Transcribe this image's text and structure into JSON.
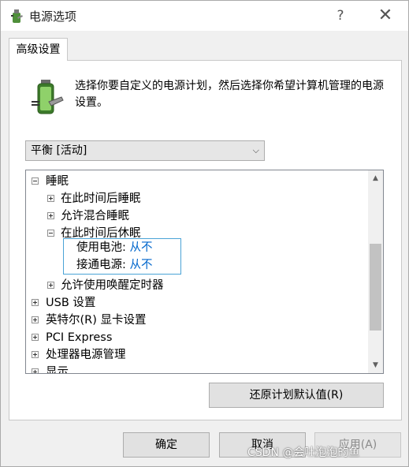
{
  "window": {
    "title": "电源选项",
    "help": "?",
    "close": "✕"
  },
  "tabs": [
    {
      "label": "高级设置"
    }
  ],
  "description": "选择你要自定义的电源计划，然后选择你希望计算机管理的电源设置。",
  "plan_select": {
    "value": "平衡 [活动]",
    "arrow": "⌵"
  },
  "tree": {
    "items": [
      {
        "label": "睡眠",
        "expander": "minus",
        "level": 0
      },
      {
        "label": "在此时间后睡眠",
        "expander": "plus",
        "level": 1
      },
      {
        "label": "允许混合睡眠",
        "expander": "plus",
        "level": 1
      },
      {
        "label": "在此时间后休眠",
        "expander": "minus",
        "level": 1
      },
      {
        "label": "允许使用唤醒定时器",
        "expander": "plus",
        "level": 1
      },
      {
        "label": "USB 设置",
        "expander": "plus",
        "level": 0
      },
      {
        "label": "英特尔(R) 显卡设置",
        "expander": "plus",
        "level": 0
      },
      {
        "label": "PCI Express",
        "expander": "plus",
        "level": 0
      },
      {
        "label": "处理器电源管理",
        "expander": "plus",
        "level": 0
      },
      {
        "label": "显示",
        "expander": "plus",
        "level": 0
      }
    ],
    "hibernate_settings": [
      {
        "label": "使用电池:",
        "value": "从不"
      },
      {
        "label": "接通电源:",
        "value": "从不"
      }
    ]
  },
  "scrollbar": {
    "up": "▲",
    "down": "▼"
  },
  "buttons": {
    "restore": "还原计划默认值(R)",
    "ok": "确定",
    "cancel": "取消",
    "apply": "应用(A)"
  },
  "watermark": "CSDN @会吐泡泡的鱼",
  "colors": {
    "accent": "#0066cc",
    "focus_border": "#4aa3d6"
  }
}
